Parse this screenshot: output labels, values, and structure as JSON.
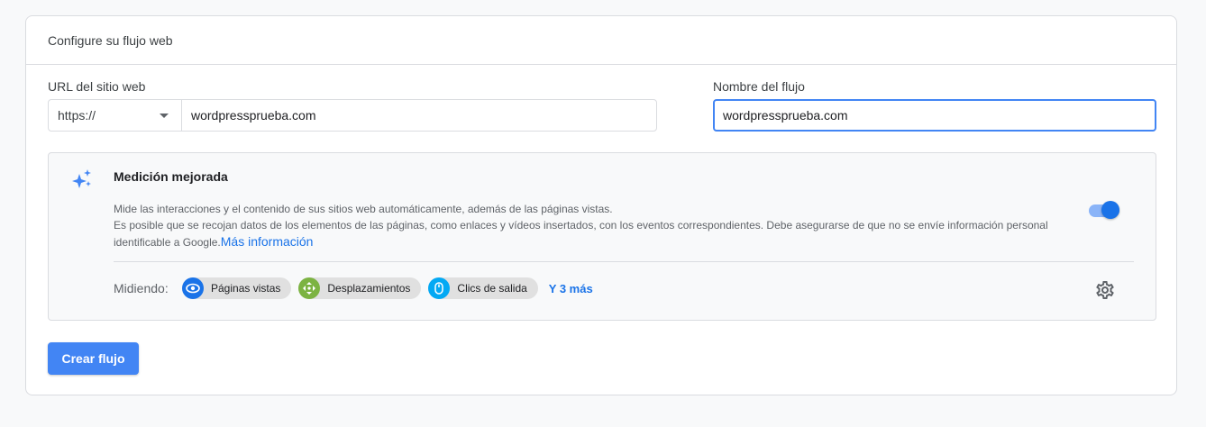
{
  "header": {
    "title": "Configure su flujo web"
  },
  "url_field": {
    "label": "URL del sitio web",
    "protocol": "https://",
    "value": "wordpressprueba.com"
  },
  "name_field": {
    "label": "Nombre del flujo",
    "value": "wordpressprueba.com"
  },
  "enhanced_measurement": {
    "title": "Medición mejorada",
    "desc_line1": "Mide las interacciones y el contenido de sus sitios web automáticamente, además de las páginas vistas.",
    "desc_line2": "Es posible que se recojan datos de los elementos de las páginas, como enlaces y vídeos insertados, con los eventos correspondientes. Debe asegurarse de que no se envíe información personal identificable a Google.",
    "link": "Más información",
    "toggle_on": true,
    "measuring_label": "Midiendo:",
    "chips": [
      {
        "label": "Páginas vistas",
        "icon": "eye-icon",
        "color": "#1a73e8"
      },
      {
        "label": "Desplazamientos",
        "icon": "scroll-icon",
        "color": "#7cb342"
      },
      {
        "label": "Clics de salida",
        "icon": "mouse-icon",
        "color": "#03a9f4"
      }
    ],
    "more": "Y 3 más"
  },
  "create_button": "Crear flujo",
  "colors": {
    "primary": "#1a73e8",
    "button": "#4285f4"
  }
}
